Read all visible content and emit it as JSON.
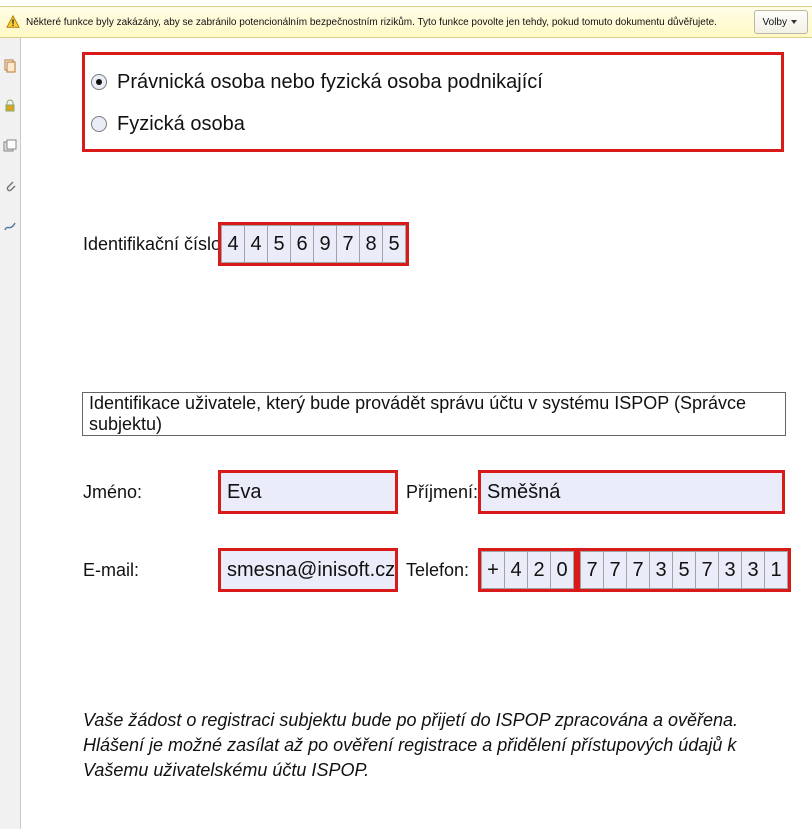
{
  "alert": {
    "text": "Některé funkce byly zakázány, aby se zabránilo potencionálním bezpečnostním rizikům. Tyto funkce povolte jen tehdy, pokud tomuto dokumentu důvěřujete.",
    "button_label": "Volby"
  },
  "person_type": {
    "option1": "Právnická osoba nebo fyzická osoba podnikající",
    "option2": "Fyzická osoba",
    "selected": 1
  },
  "ident": {
    "label": "Identifikační číslo:",
    "digits": [
      "4",
      "4",
      "5",
      "6",
      "9",
      "7",
      "8",
      "5"
    ]
  },
  "section_header": "Identifikace uživatele, který bude provádět správu účtu v systému ISPOP (Správce subjektu)",
  "labels": {
    "firstname": "Jméno:",
    "lastname": "Příjmení:",
    "email": "E-mail:",
    "phone": "Telefon:"
  },
  "user": {
    "firstname": "Eva",
    "lastname": "Směšná",
    "email": "smesna@inisoft.cz"
  },
  "phone": {
    "prefix": [
      "+",
      "4",
      "2",
      "0"
    ],
    "number": [
      "7",
      "7",
      "7",
      "3",
      "5",
      "7",
      "3",
      "3",
      "1"
    ]
  },
  "info_paragraph": "Vaše žádost o registraci subjektu bude po přijetí do ISPOP zpracována a ověřena. Hlášení je možné zasílat až po ověření registrace a přidělení přístupových údajů k Vašemu uživatelskému účtu ISPOP."
}
